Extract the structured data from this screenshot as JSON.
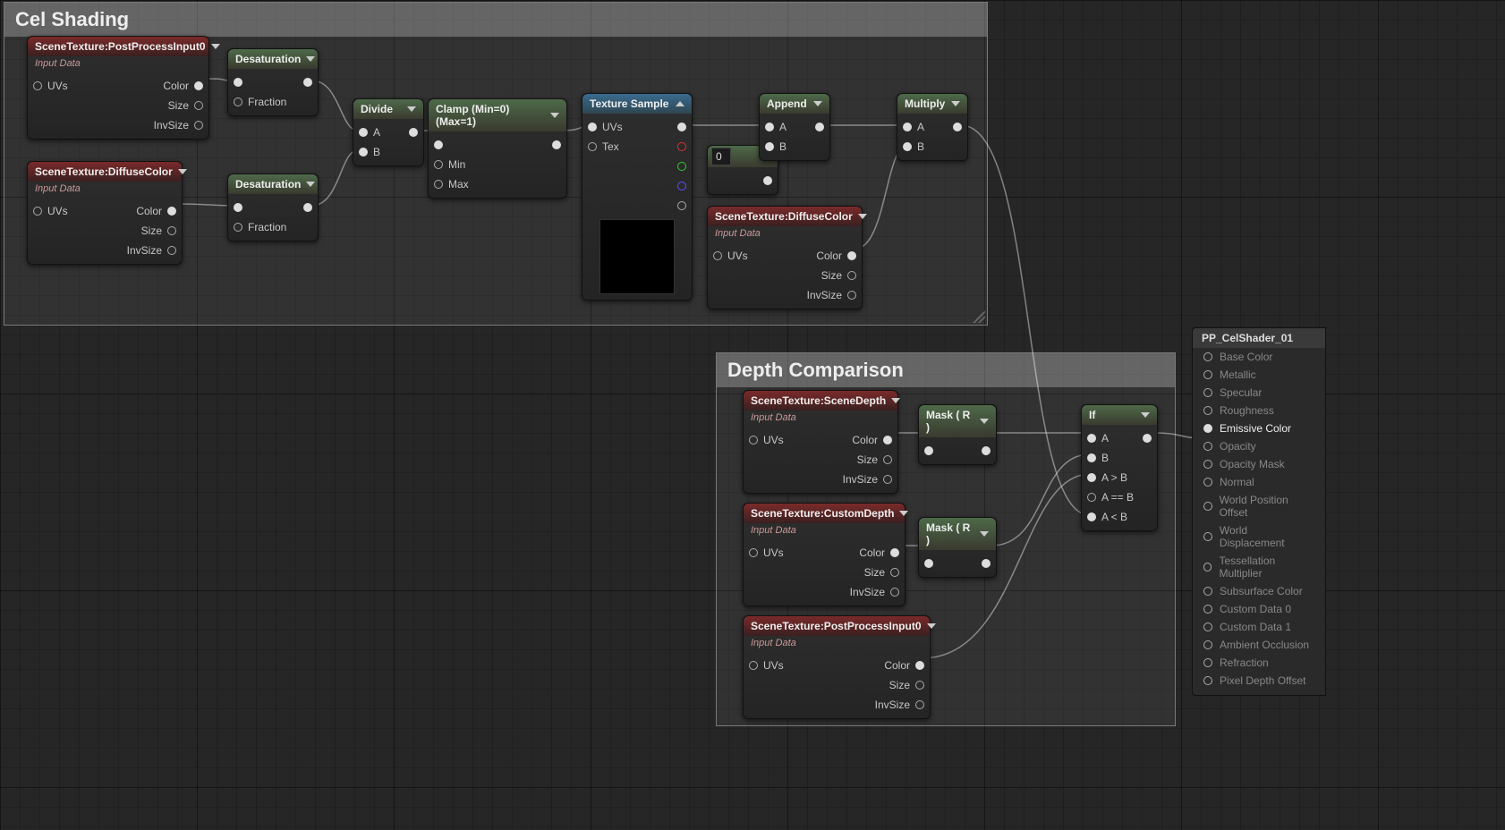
{
  "comments": {
    "celShading": {
      "title": "Cel Shading"
    },
    "depthComparison": {
      "title": "Depth Comparison"
    }
  },
  "labels": {
    "inputData": "Input Data",
    "uvs": "UVs",
    "tex": "Tex",
    "color": "Color",
    "size": "Size",
    "invsize": "InvSize",
    "fraction": "Fraction",
    "a": "A",
    "b": "B",
    "min": "Min",
    "max": "Max",
    "aGtB": "A > B",
    "aEqB": "A == B",
    "aLtB": "A < B"
  },
  "nodes": {
    "sceneTexPP0": {
      "title": "SceneTexture:PostProcessInput0"
    },
    "sceneTexDiffuse": {
      "title": "SceneTexture:DiffuseColor"
    },
    "desat1": {
      "title": "Desaturation"
    },
    "desat2": {
      "title": "Desaturation"
    },
    "divide": {
      "title": "Divide"
    },
    "clamp": {
      "title": "Clamp (Min=0) (Max=1)"
    },
    "texSample": {
      "title": "Texture Sample"
    },
    "append": {
      "title": "Append"
    },
    "constZero": {
      "value": "0"
    },
    "multiply": {
      "title": "Multiply"
    },
    "sceneTexDiffuse2": {
      "title": "SceneTexture:DiffuseColor"
    },
    "sceneDepth": {
      "title": "SceneTexture:SceneDepth"
    },
    "customDepth": {
      "title": "SceneTexture:CustomDepth"
    },
    "ppInput0b": {
      "title": "SceneTexture:PostProcessInput0"
    },
    "mask1": {
      "title": "Mask ( R )"
    },
    "mask2": {
      "title": "Mask ( R )"
    },
    "ifNode": {
      "title": "If"
    }
  },
  "output": {
    "title": "PP_CelShader_01",
    "pins": [
      {
        "label": "Base Color",
        "active": false
      },
      {
        "label": "Metallic",
        "active": false
      },
      {
        "label": "Specular",
        "active": false
      },
      {
        "label": "Roughness",
        "active": false
      },
      {
        "label": "Emissive Color",
        "active": true
      },
      {
        "label": "Opacity",
        "active": false
      },
      {
        "label": "Opacity Mask",
        "active": false
      },
      {
        "label": "Normal",
        "active": false
      },
      {
        "label": "World Position Offset",
        "active": false
      },
      {
        "label": "World Displacement",
        "active": false
      },
      {
        "label": "Tessellation Multiplier",
        "active": false
      },
      {
        "label": "Subsurface Color",
        "active": false
      },
      {
        "label": "Custom Data 0",
        "active": false
      },
      {
        "label": "Custom Data 1",
        "active": false
      },
      {
        "label": "Ambient Occlusion",
        "active": false
      },
      {
        "label": "Refraction",
        "active": false
      },
      {
        "label": "Pixel Depth Offset",
        "active": false
      }
    ]
  }
}
